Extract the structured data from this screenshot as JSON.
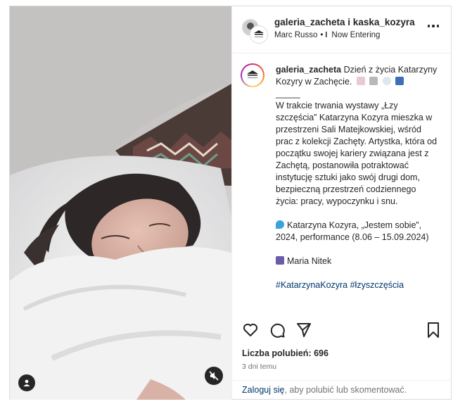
{
  "header": {
    "users": "galeria_zacheta i kaska_kozyra",
    "author": "Marc Russo",
    "separator": "•",
    "audio": "Now Entering",
    "more_icon": "more-horizontal-icon"
  },
  "caption": {
    "username": "galeria_zacheta",
    "intro": "Dzień z życia Katarzyny Kozyry w Zachęcie.",
    "divider": "_____",
    "body": "W trakcie trwania wystawy „Łzy szczęścia” Katarzyna Kozyra mieszka w przestrzeni Sali Matejkowskiej, wśród prac z kolekcji Zachęty. Artystka, która od początku swojej kariery związana jest z Zachętą, postanowiła potraktować instytucję sztuki jako swój drugi dom, bezpieczną przestrzeń codziennego życia: pracy, wypoczynku i snu.",
    "work": "Katarzyna Kozyra, „Jestem sobie”, 2024, performance (8.06 – 15.09.2024)",
    "credit": "Maria Nitek",
    "hashtags": "#KatarzynaKozyra #łzyszczęścia"
  },
  "actions": {
    "like_icon": "heart-icon",
    "comment_icon": "comment-icon",
    "share_icon": "send-icon",
    "save_icon": "bookmark-icon"
  },
  "likes": "Liczba polubień: 696",
  "date": "3 dni temu",
  "login": {
    "link": "Zaloguj się",
    "text": ", aby polubić lub skomentować."
  },
  "colors": {
    "link": "#00376b",
    "muted": "#737373",
    "border": "#dbdbdb"
  }
}
